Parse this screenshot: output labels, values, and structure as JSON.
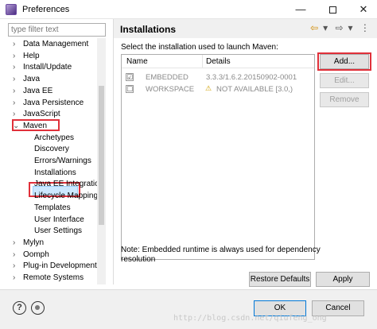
{
  "window": {
    "title": "Preferences",
    "controls": {
      "minimize": "—",
      "close": "✕"
    }
  },
  "sidebar": {
    "filter_placeholder": "type filter text",
    "items": [
      {
        "label": "Data Management",
        "level": "top",
        "arrow": "›"
      },
      {
        "label": "Help",
        "level": "top",
        "arrow": "›"
      },
      {
        "label": "Install/Update",
        "level": "top",
        "arrow": "›"
      },
      {
        "label": "Java",
        "level": "top",
        "arrow": "›"
      },
      {
        "label": "Java EE",
        "level": "top",
        "arrow": "›"
      },
      {
        "label": "Java Persistence",
        "level": "top",
        "arrow": "›"
      },
      {
        "label": "JavaScript",
        "level": "top",
        "arrow": "›"
      },
      {
        "label": "Maven",
        "level": "top",
        "arrow": "⌄"
      },
      {
        "label": "Archetypes",
        "level": "child"
      },
      {
        "label": "Discovery",
        "level": "child"
      },
      {
        "label": "Errors/Warnings",
        "level": "child"
      },
      {
        "label": "Installations",
        "level": "child"
      },
      {
        "label": "Java EE Integration",
        "level": "child"
      },
      {
        "label": "Lifecycle Mapping",
        "level": "child"
      },
      {
        "label": "Templates",
        "level": "child"
      },
      {
        "label": "User Interface",
        "level": "child"
      },
      {
        "label": "User Settings",
        "level": "child"
      },
      {
        "label": "Mylyn",
        "level": "top",
        "arrow": "›"
      },
      {
        "label": "Oomph",
        "level": "top",
        "arrow": "›"
      },
      {
        "label": "Plug-in Development",
        "level": "top",
        "arrow": "›"
      },
      {
        "label": "Remote Systems",
        "level": "top",
        "arrow": "›"
      }
    ]
  },
  "page": {
    "title": "Installations",
    "nav_icons": {
      "back": "⇦",
      "back_menu": "▾",
      "forward": "⇨",
      "forward_menu": "▾",
      "view_menu": "⋮"
    },
    "description": "Select the installation used to launch Maven:",
    "table": {
      "headers": {
        "name": "Name",
        "details": "Details"
      },
      "rows": [
        {
          "checked": "☑",
          "name": "EMBEDDED",
          "warn": "",
          "details": "3.3.3/1.6.2.20150902-0001"
        },
        {
          "checked": "☐",
          "name": "WORKSPACE",
          "warn": "⚠",
          "details": "NOT AVAILABLE [3.0,)"
        }
      ]
    },
    "buttons": {
      "add": "Add...",
      "edit": "Edit...",
      "remove": "Remove"
    },
    "note": "Note: Embedded runtime is always used for dependency resolution",
    "restore_defaults": "Restore Defaults",
    "apply": "Apply"
  },
  "footer": {
    "help_icon": "?",
    "ok": "OK",
    "cancel": "Cancel"
  },
  "watermark": "http://blog.csdn.net/qiufeng_ong",
  "colors": {
    "highlight_red": "#e0303a",
    "selection_blue": "#cce8ff",
    "warning_yellow": "#d0a000"
  }
}
